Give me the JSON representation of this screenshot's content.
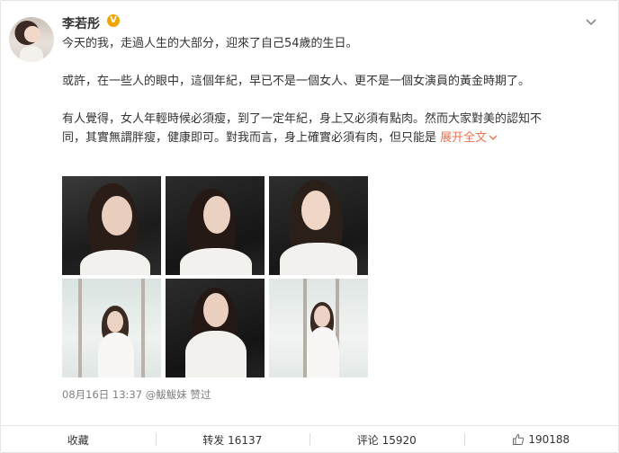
{
  "post": {
    "username": "李若彤",
    "verified_badge": "V",
    "paragraph1": "今天的我，走過人生的大部分，迎來了自己54歲的生日。",
    "paragraph2": "或許，在一些人的眼中，這個年紀，早已不是一個女人、更不是一個女演員的黃金時期了。",
    "paragraph3_line1": "有人覺得，女人年輕時候必須瘦，到了一定年紀，身上又必須有點肉。然而大家對美的認知不",
    "paragraph3_line2": "同，其實無謂胖瘦，健康即可。對我而言，身上確實必須有肉，但只能是",
    "expand_label": "展开全文",
    "expand_icon": "chevron-down-icon",
    "date": "08月16日 13:37",
    "like_by_user": "@鮁鮁妹",
    "like_by_suffix": "赞过",
    "accent_color": "#eb7350"
  },
  "photos": [
    {
      "alt": "photo-1"
    },
    {
      "alt": "photo-2"
    },
    {
      "alt": "photo-3"
    },
    {
      "alt": "photo-4"
    },
    {
      "alt": "photo-5"
    },
    {
      "alt": "photo-6"
    }
  ],
  "footer": {
    "collect_label": "收藏",
    "repost_label": "转发 16137",
    "comment_label": "评论 15920",
    "like_count": "190188"
  }
}
